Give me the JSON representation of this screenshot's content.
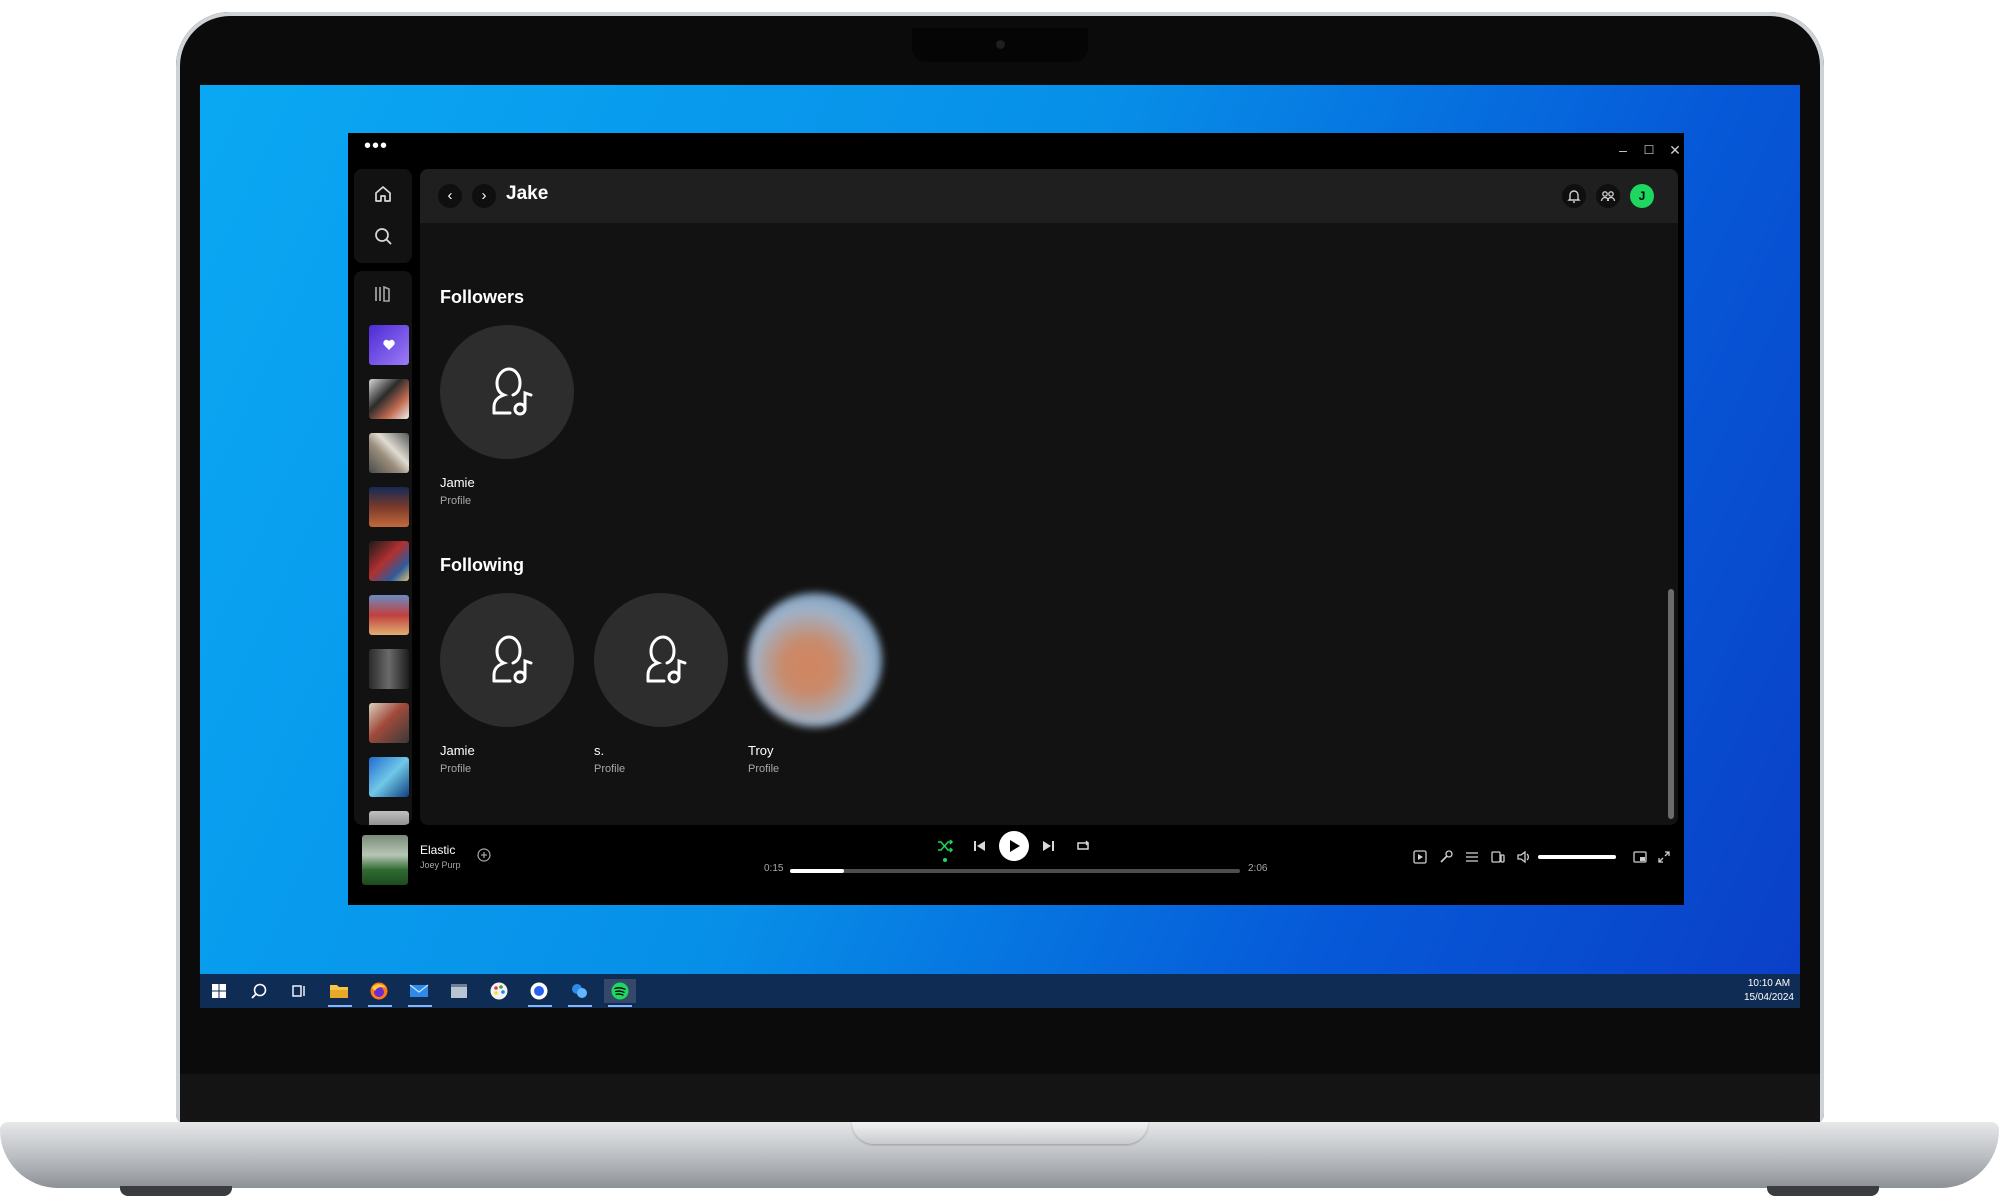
{
  "window": {
    "menu": "•••",
    "minimize": "–",
    "maximize": "☐",
    "close": "✕"
  },
  "header": {
    "back": "‹",
    "forward": "›",
    "title": "Jake",
    "user_initial": "J"
  },
  "followers": {
    "title": "Followers",
    "items": [
      {
        "name": "Jamie",
        "type": "Profile"
      }
    ]
  },
  "following": {
    "title": "Following",
    "items": [
      {
        "name": "Jamie",
        "type": "Profile"
      },
      {
        "name": "s.",
        "type": "Profile"
      },
      {
        "name": "Troy",
        "type": "Profile"
      }
    ]
  },
  "now_playing": {
    "title": "Elastic",
    "artist": "Joey Purp",
    "elapsed": "0:15",
    "duration": "2:06",
    "progress_pct": 12,
    "volume_pct": 100
  },
  "icons": [
    "home-icon",
    "search-icon",
    "library-icon",
    "bell-icon",
    "friends-icon",
    "shuffle-icon",
    "previous-icon",
    "play-icon",
    "next-icon",
    "repeat-icon"
  ],
  "colors": {
    "accent": "#1ed760",
    "background": "#121212",
    "header": "#1f1f1f"
  },
  "taskbar": {
    "time": "10:10 AM",
    "date": "15/04/2024"
  }
}
